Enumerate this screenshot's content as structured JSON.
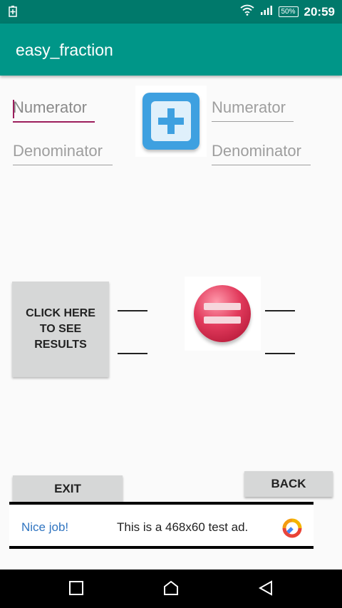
{
  "status_bar": {
    "time": "20:59",
    "battery": "50%",
    "icons": [
      "battery-saver-icon",
      "wifi-icon",
      "signal-icon"
    ]
  },
  "app_bar": {
    "title": "easy_fraction"
  },
  "left_fraction": {
    "numerator_placeholder": "Numerator",
    "denominator_placeholder": "Denominator"
  },
  "right_fraction": {
    "numerator_placeholder": "Numerator",
    "denominator_placeholder": "Denominator"
  },
  "operator_icon": "plus-icon",
  "equals_icon": "equals-icon",
  "result_button": {
    "label": "CLICK HERE TO SEE RESULTS"
  },
  "exit_button": {
    "label": "EXIT"
  },
  "back_button": {
    "label": "BACK"
  },
  "ad": {
    "tagline": "Nice job!",
    "text": "This is a 468x60 test ad."
  },
  "nav_bar": {
    "icons": [
      "recents-icon",
      "home-icon",
      "back-icon"
    ]
  },
  "colors": {
    "app_bar": "#009688",
    "status_bar": "#00796b",
    "accent": "#9c1d5c",
    "button": "#d6d7d7"
  }
}
